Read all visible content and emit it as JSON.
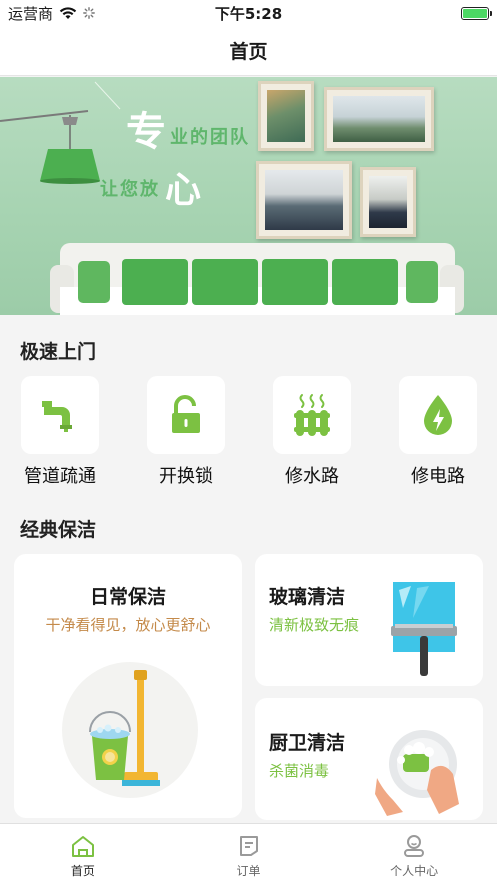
{
  "status_bar": {
    "carrier": "运营商",
    "time": "下午5:28",
    "battery_level": 1.0
  },
  "nav": {
    "title": "首页"
  },
  "banner": {
    "slogan_big_1": "专",
    "slogan_small_1": "业的团队",
    "slogan_small_2": "让您放",
    "slogan_big_2": "心"
  },
  "quick_section": {
    "title": "极速上门",
    "items": [
      {
        "label": "管道疏通",
        "icon": "pipe-icon"
      },
      {
        "label": "开换锁",
        "icon": "unlock-icon"
      },
      {
        "label": "修水路",
        "icon": "water-heater-icon"
      },
      {
        "label": "修电路",
        "icon": "electric-drop-icon"
      }
    ]
  },
  "clean_section": {
    "title": "经典保洁",
    "cards": [
      {
        "title": "日常保洁",
        "subtitle": "干净看得见，放心更舒心",
        "icon": "bucket-mop-icon"
      },
      {
        "title": "玻璃清洁",
        "subtitle": "清新极致无痕",
        "icon": "squeegee-icon"
      },
      {
        "title": "厨卫清洁",
        "subtitle": "杀菌消毒",
        "icon": "dish-washing-icon"
      }
    ]
  },
  "tab_bar": {
    "tabs": [
      {
        "label": "首页",
        "icon": "home-icon",
        "active": true
      },
      {
        "label": "订单",
        "icon": "order-icon",
        "active": false
      },
      {
        "label": "个人中心",
        "icon": "profile-icon",
        "active": false
      }
    ]
  },
  "colors": {
    "accent": "#7cc142",
    "subtitle": "#c48a4a",
    "background": "#f4f4f4"
  }
}
